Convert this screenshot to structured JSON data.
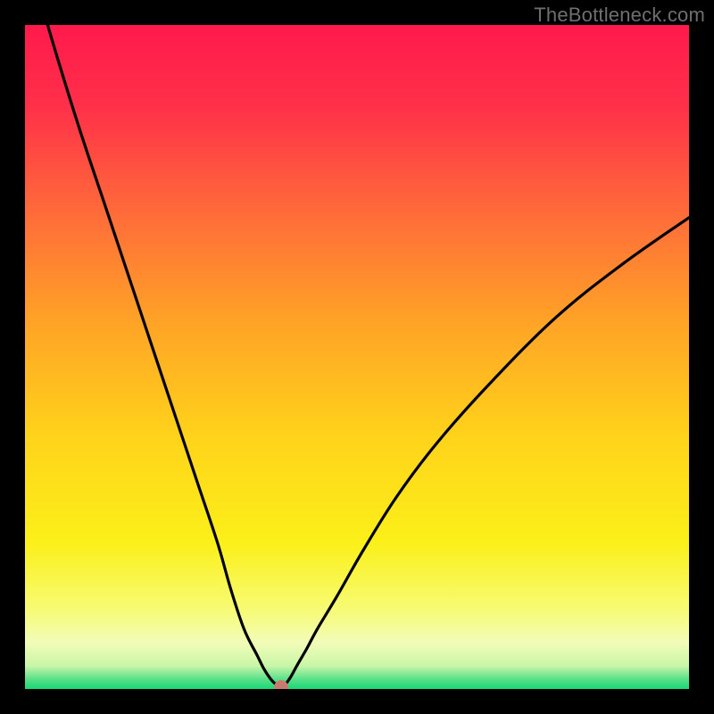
{
  "watermark": {
    "text": "TheBottleneck.com"
  },
  "colors": {
    "black": "#000000",
    "curve": "#000000",
    "marker": "#c77b6e"
  },
  "chart_data": {
    "type": "line",
    "title": "",
    "xlabel": "",
    "ylabel": "",
    "xlim": [
      0,
      100
    ],
    "ylim": [
      0,
      100
    ],
    "gradient_stops": [
      {
        "offset": 0.0,
        "color": "#ff1a4c"
      },
      {
        "offset": 0.12,
        "color": "#ff2f49"
      },
      {
        "offset": 0.28,
        "color": "#ff6a3a"
      },
      {
        "offset": 0.45,
        "color": "#ffa426"
      },
      {
        "offset": 0.62,
        "color": "#ffd31a"
      },
      {
        "offset": 0.78,
        "color": "#fbf019"
      },
      {
        "offset": 0.88,
        "color": "#f7fb74"
      },
      {
        "offset": 0.93,
        "color": "#f2fcb8"
      },
      {
        "offset": 0.965,
        "color": "#c9f6a8"
      },
      {
        "offset": 0.985,
        "color": "#5be08a"
      },
      {
        "offset": 1.0,
        "color": "#17d874"
      }
    ],
    "series": [
      {
        "name": "bottleneck-curve",
        "x": [
          0,
          4,
          8,
          12,
          16,
          20,
          23,
          26,
          29,
          31,
          33,
          35,
          36,
          37,
          37.8,
          38.6,
          39.2,
          40,
          41,
          42.5,
          44,
          47,
          51,
          56,
          62,
          70,
          80,
          90,
          100
        ],
        "values": [
          112,
          98,
          85,
          73,
          61,
          49,
          40,
          31,
          22,
          15,
          9,
          5,
          3,
          1.5,
          0.7,
          0.3,
          0.7,
          1.8,
          3.6,
          6.2,
          9,
          14,
          21,
          29,
          37,
          46,
          56,
          64,
          71
        ]
      }
    ],
    "minimum_marker": {
      "x": 38.6,
      "y": 0.3
    }
  }
}
